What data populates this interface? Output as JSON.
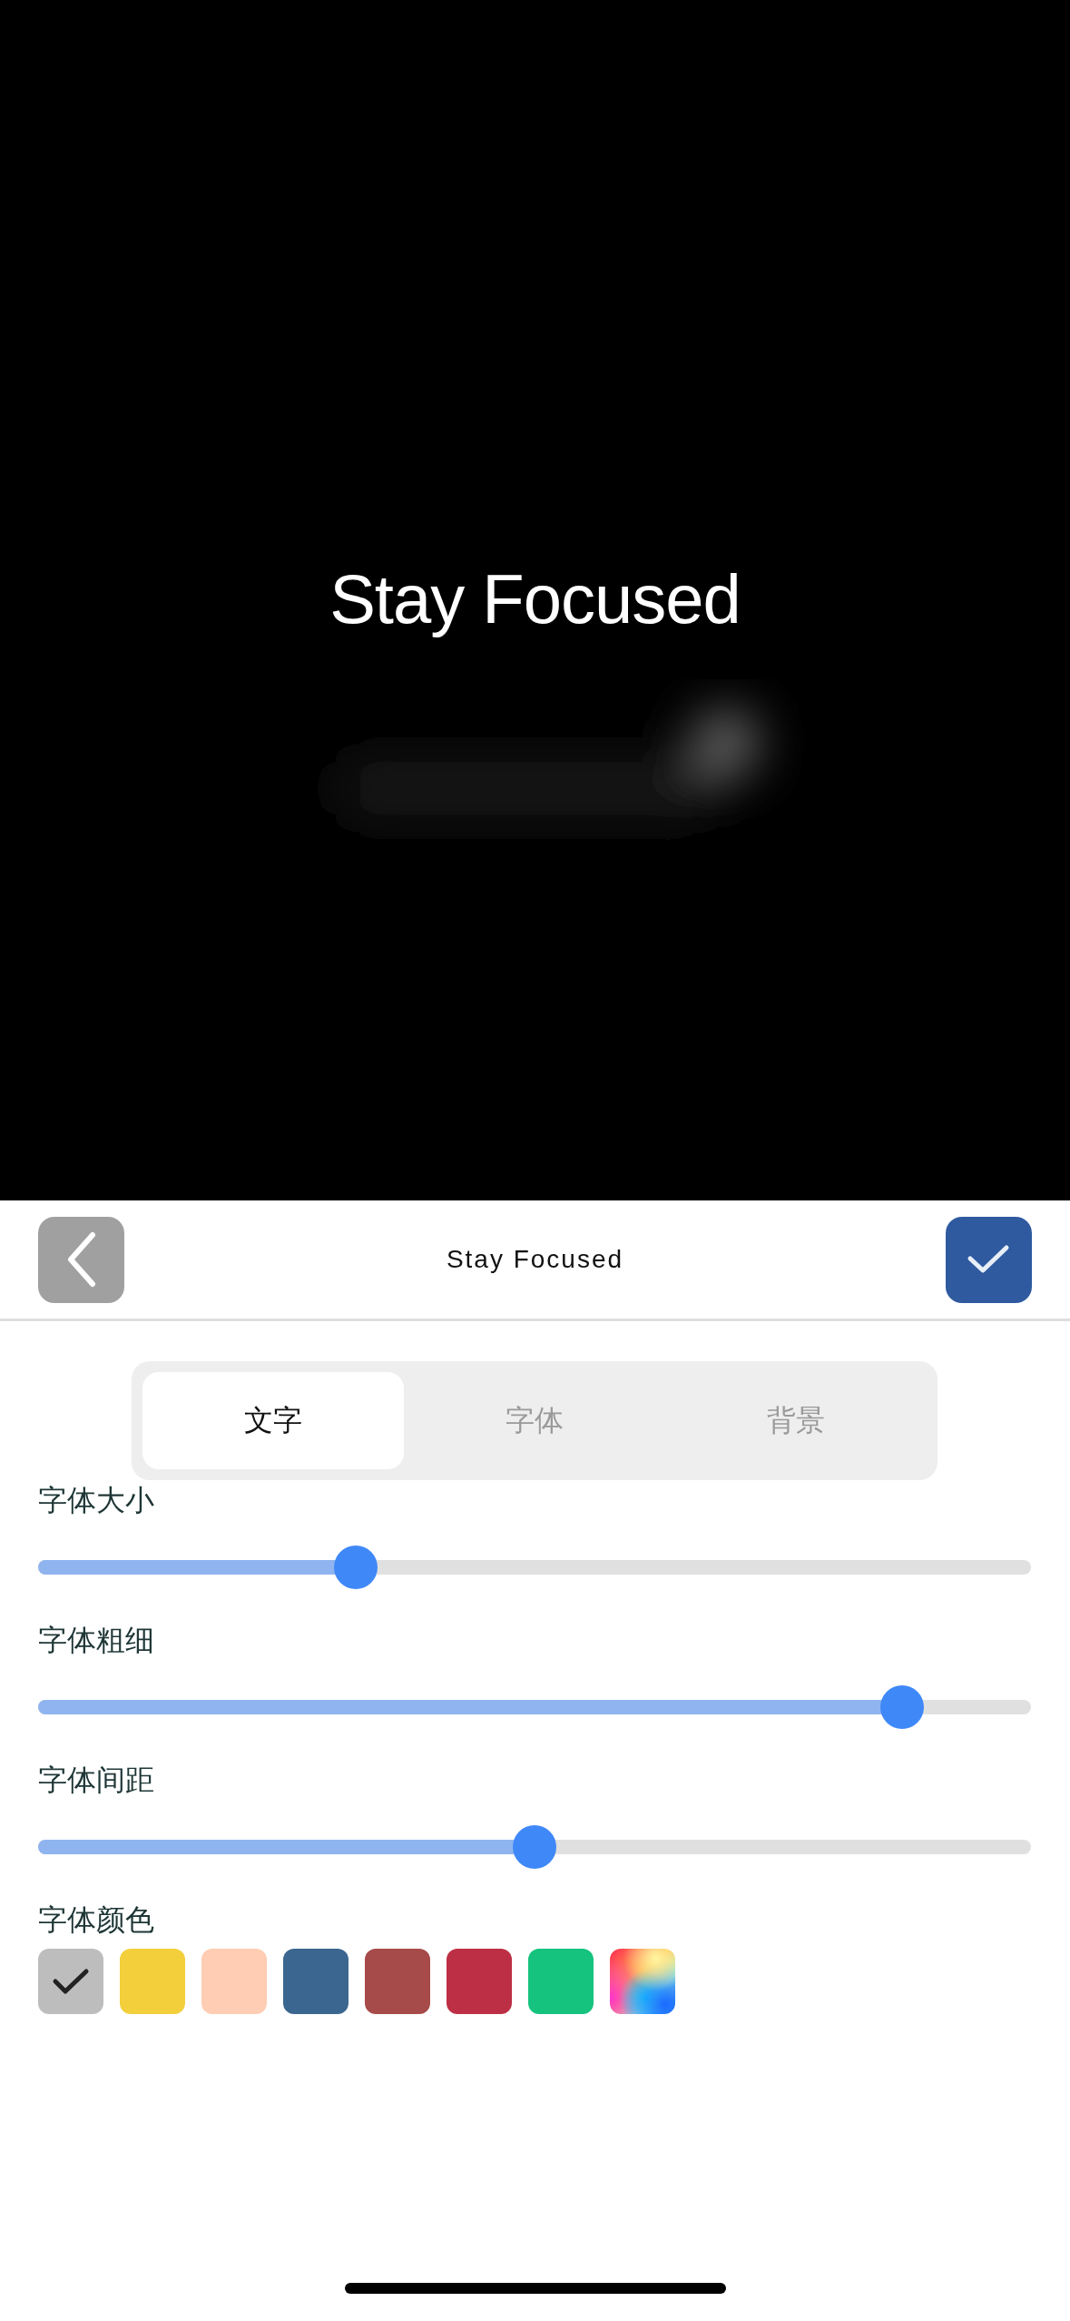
{
  "preview": {
    "text": "Stay Focused"
  },
  "header": {
    "title": "Stay Focused"
  },
  "tabs": [
    {
      "label": "文字",
      "selected": true
    },
    {
      "label": "字体",
      "selected": false
    },
    {
      "label": "背景",
      "selected": false
    }
  ],
  "sliders": [
    {
      "label": "字体大小",
      "level": 0.32
    },
    {
      "label": "字体粗细",
      "level": 0.87
    },
    {
      "label": "字体间距",
      "level": 0.5
    }
  ],
  "color_section": {
    "label": "字体颜色",
    "swatches": [
      {
        "kind": "solid",
        "color": "#bdbdbd",
        "selected": true
      },
      {
        "kind": "solid",
        "color": "#f3cf3b",
        "selected": false
      },
      {
        "kind": "solid",
        "color": "#fecdb3",
        "selected": false
      },
      {
        "kind": "solid",
        "color": "#3b668f",
        "selected": false
      },
      {
        "kind": "solid",
        "color": "#a64b4a",
        "selected": false
      },
      {
        "kind": "solid",
        "color": "#bd2f45",
        "selected": false
      },
      {
        "kind": "solid",
        "color": "#15c37e",
        "selected": false
      },
      {
        "kind": "gradient",
        "selected": false
      }
    ]
  }
}
